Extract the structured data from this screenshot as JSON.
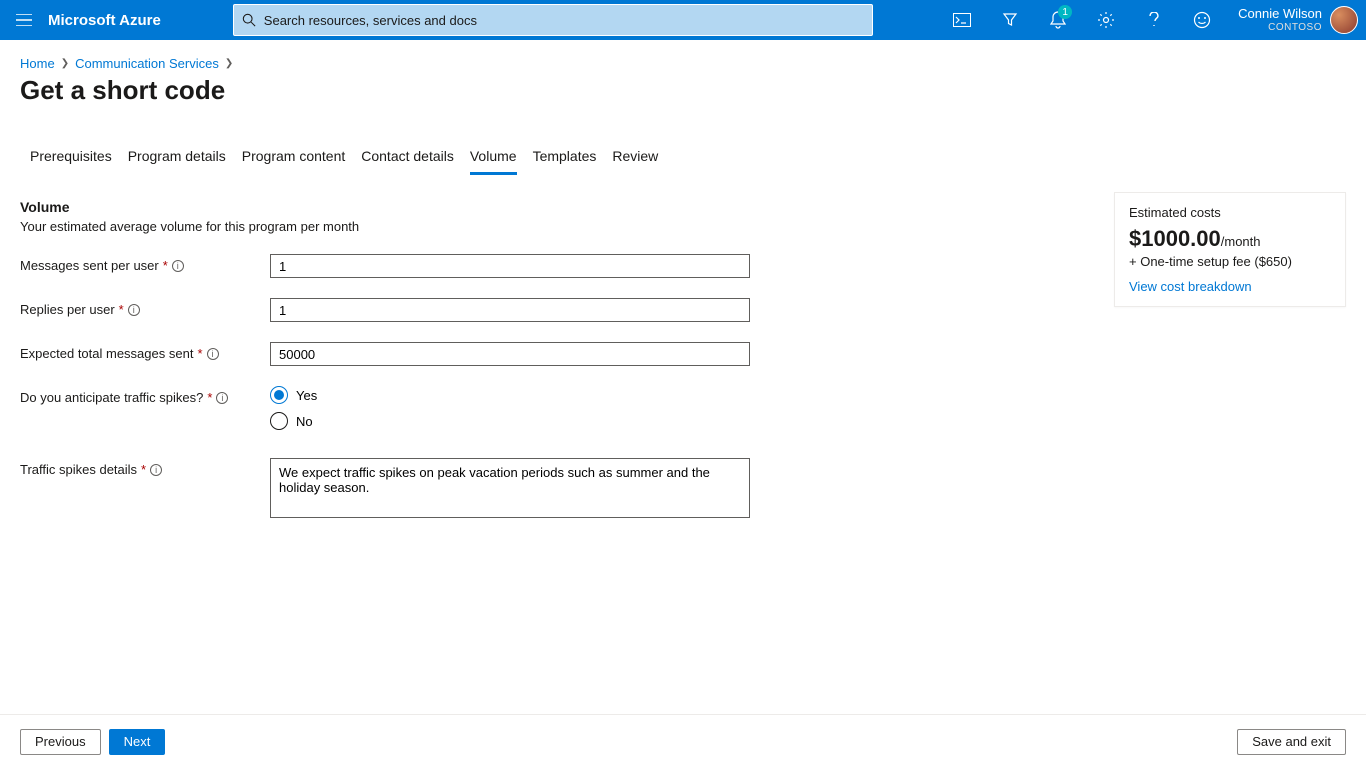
{
  "header": {
    "brand": "Microsoft Azure",
    "search_placeholder": "Search resources, services and docs",
    "notification_count": "1",
    "user_name": "Connie Wilson",
    "tenant": "CONTOSO"
  },
  "breadcrumbs": {
    "home": "Home",
    "service": "Communication Services"
  },
  "page_title": "Get a short code",
  "tabs": [
    {
      "label": "Prerequisites"
    },
    {
      "label": "Program details"
    },
    {
      "label": "Program content"
    },
    {
      "label": "Contact details"
    },
    {
      "label": "Volume",
      "active": true
    },
    {
      "label": "Templates"
    },
    {
      "label": "Review"
    }
  ],
  "section": {
    "heading": "Volume",
    "subheading": "Your estimated average volume for this program per month"
  },
  "fields": {
    "msgs_per_user": {
      "label": "Messages sent per user",
      "value": "1"
    },
    "replies_per_user": {
      "label": "Replies per user",
      "value": "1"
    },
    "expected_total": {
      "label": "Expected total messages sent",
      "value": "50000"
    },
    "traffic_spikes": {
      "label": "Do you anticipate traffic spikes?",
      "yes": "Yes",
      "no": "No",
      "selected": "yes"
    },
    "spikes_details": {
      "label": "Traffic spikes details",
      "value": "We expect traffic spikes on peak vacation periods such as summer and the holiday season."
    }
  },
  "cost_card": {
    "heading": "Estimated costs",
    "amount": "$1000.00",
    "per": "/month",
    "setup": "+ One-time setup fee ($650)",
    "link": "View cost breakdown"
  },
  "footer": {
    "prev": "Previous",
    "next": "Next",
    "save": "Save and exit"
  }
}
